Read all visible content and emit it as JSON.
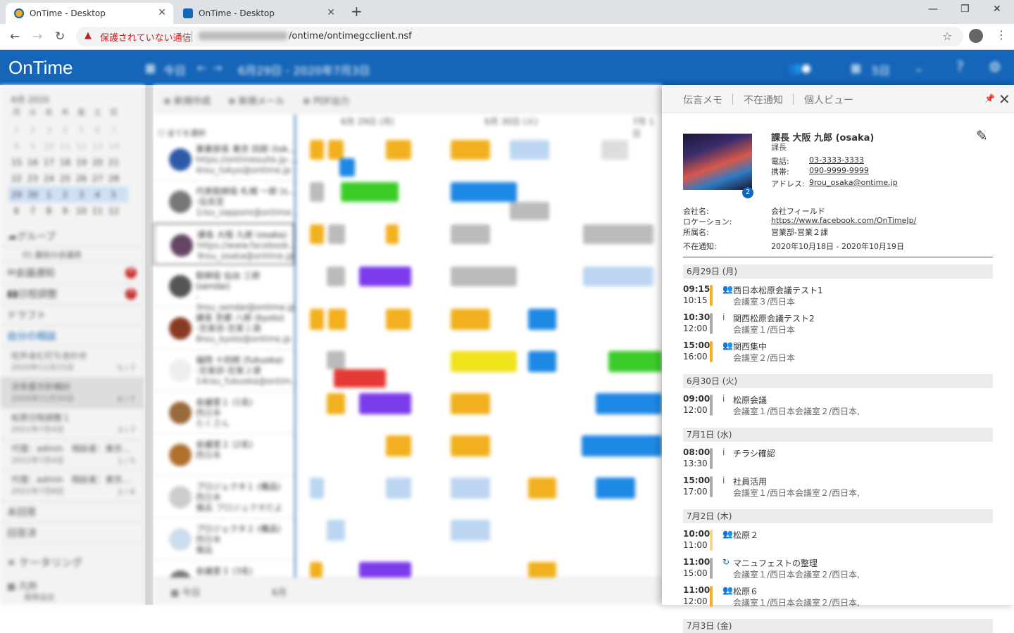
{
  "browser": {
    "tabs": [
      {
        "label": "OnTime - Desktop",
        "active": true
      },
      {
        "label": "OnTime - Desktop",
        "active": false
      }
    ],
    "new_tab_icon": "plus-icon",
    "security_warning": "保護されていない通信",
    "url_path": "/ontime/ontimegcclient.nsf",
    "window_controls": [
      "minimize-icon",
      "restore-icon",
      "close-icon"
    ]
  },
  "app": {
    "logo": "OnTime",
    "today": "今日",
    "date_range": "6月29日 - 2020年7月3日",
    "view_days": "5日",
    "accent_color": "#1565b8"
  },
  "sidebar": {
    "month": "6月 2020",
    "weekdays": [
      "月",
      "火",
      "水",
      "木",
      "金",
      "土",
      "日"
    ],
    "weeks": [
      [
        "1",
        "2",
        "3",
        "4",
        "5",
        "6",
        "7"
      ],
      [
        "8",
        "9",
        "10",
        "11",
        "12",
        "13",
        "14"
      ],
      [
        "15",
        "16",
        "17",
        "18",
        "19",
        "20",
        "21"
      ],
      [
        "22",
        "23",
        "24",
        "25",
        "26",
        "27",
        "28"
      ],
      [
        "29",
        "30",
        "1",
        "2",
        "3",
        "4",
        "5"
      ],
      [
        "6",
        "7",
        "8",
        "9",
        "10",
        "11",
        "12"
      ]
    ],
    "group_label": "グループ",
    "group_sub": "01.最段の会議用",
    "meeting_notice": "会議通知",
    "meeting_notice_count": "8",
    "schedule_adjust": "日程調整",
    "schedule_adjust_count": "5",
    "draft": "ドラフト",
    "my_consult": "自分の相談",
    "items": [
      {
        "title": "社外含む打ち合わせ",
        "date": "2020年11月15日",
        "count": "5 / 7"
      },
      {
        "title": "次年度方針検討",
        "date": "2020年11月30日",
        "count": "6 / 7"
      },
      {
        "title": "松原日程調整１",
        "date": "2021年7月4日",
        "count": "3 / 7"
      },
      {
        "title": "代理：admin　相談者：東京...",
        "date": "2021年7月4日",
        "count": "1 / 5"
      },
      {
        "title": "代理：admin　相談者：東京...",
        "date": "2021年7月8日",
        "count": "2 / 6"
      }
    ],
    "unanswered": "未回答",
    "answered": "回答済",
    "catering": "ケータリング",
    "legend": "凡例",
    "legend_sub": "標準設定"
  },
  "main": {
    "new_create": "新規作成",
    "new_mail": "新規メール",
    "pdf": "PDF出力",
    "select_all": "全てを選択",
    "day_headers": [
      "6月 29日 (月)",
      "6月 30日 (火)",
      "7月 1日"
    ],
    "people": [
      {
        "name": "事業部長 東京 四郎 (tok...",
        "sub": "https://ontimesuite.jp-...",
        "mail": "4rou_tokyo@ontime.jp"
      },
      {
        "name": "代表取締役 札幌 一郎 (s...",
        "sub": "-役員室",
        "mail": "1rou_sapporo@ontime..."
      },
      {
        "name": "課長 大阪 九郎 (osaka)",
        "sub": "https://www.facebook...",
        "mail": "9rou_osaka@ontime.jp"
      },
      {
        "name": "取締役 仙台 三郎 (sendai)",
        "sub": "-",
        "mail": "3rou_sendai@ontime.jp"
      },
      {
        "name": "課長 京都 八郎 (kyoto)",
        "sub": "-営業部-営業１課",
        "mail": "8rou_kyoto@ontime.jp"
      },
      {
        "name": "福岡 十四郎 (fukuoka)",
        "sub": "-営業部-営業２課",
        "mail": "14rou_fukuoka@ontim..."
      },
      {
        "name": "会議室１ (1名)",
        "sub": "西日本",
        "mail": "たくさん"
      },
      {
        "name": "会議室２ (2名)",
        "sub": "西日本",
        "mail": ""
      },
      {
        "name": "プロジェクタ１ (備品)",
        "sub": "西日本",
        "mail": "備品 プロジェクタだよ"
      },
      {
        "name": "プロジェクタ２ (備品)",
        "sub": "西日本",
        "mail": "備品"
      },
      {
        "name": "会議室３ (3名)",
        "sub": "",
        "mail": ""
      }
    ],
    "bottom_today": "今日",
    "bottom_month": "6月"
  },
  "panel": {
    "tabs": [
      "伝言メモ",
      "不在通知",
      "個人ビュー"
    ],
    "badge": "2",
    "name": "課長 大阪 九郎 (osaka)",
    "title": "課長",
    "phone_label": "電話:",
    "phone": "03-3333-3333",
    "mobile_label": "携帯:",
    "mobile": "090-9999-9999",
    "address_label": "アドレス:",
    "address": "9rou_osaka@ontime.jp",
    "company_label": "会社名:",
    "company": "会社フィールド",
    "location_label": "ロケーション:",
    "location": "https://www.facebook.com/OnTimeJp/",
    "dept_label": "所属名:",
    "dept": "営業部-営業２課",
    "absence_label": "不在通知:",
    "absence": "2020年10月18日 - 2020年10月19日",
    "days": [
      {
        "label": "6月29日 (月)",
        "events": [
          {
            "start": "09:15",
            "end": "10:15",
            "title": "西日本松原会議テスト1",
            "loc": "会議室３/西日本",
            "color": "#f2b01e",
            "icon": "people-icon"
          },
          {
            "start": "10:30",
            "end": "12:00",
            "title": "関西松原会議テスト2",
            "loc": "会議室１/西日本",
            "color": "#aaaaaa",
            "icon": "info-icon"
          },
          {
            "start": "15:00",
            "end": "16:00",
            "title": "関西集中",
            "loc": "会議室２/西日本",
            "color": "#f2b01e",
            "icon": "people-icon"
          }
        ]
      },
      {
        "label": "6月30日 (火)",
        "events": [
          {
            "start": "09:00",
            "end": "12:00",
            "title": "松原会議",
            "loc": "会議室１/西日本会議室２/西日本,",
            "color": "#aaaaaa",
            "icon": "info-icon"
          }
        ]
      },
      {
        "label": "7月1日 (水)",
        "events": [
          {
            "start": "08:00",
            "end": "13:30",
            "title": "チラシ確認",
            "loc": "",
            "color": "#aaaaaa",
            "icon": "info-icon"
          },
          {
            "start": "15:00",
            "end": "17:00",
            "title": "社員活用",
            "loc": "会議室１/西日本会議室２/西日本,",
            "color": "#aaaaaa",
            "icon": "info-icon"
          }
        ]
      },
      {
        "label": "7月2日 (木)",
        "events": [
          {
            "start": "10:00",
            "end": "11:00",
            "title": "松原２",
            "loc": "",
            "color": "#f7d88a",
            "icon": "people-icon"
          },
          {
            "start": "11:00",
            "end": "15:00",
            "title": "マニュフェストの整理",
            "loc": "会議室１/西日本会議室２/西日本,",
            "color": "#aaaaaa",
            "icon": "repeat-icon"
          },
          {
            "start": "11:00",
            "end": "12:00",
            "title": "松原６",
            "loc": "会議室１/西日本会議室２/西日本,",
            "color": "#f2b01e",
            "icon": "people-icon"
          }
        ]
      },
      {
        "label": "7月3日 (金)",
        "events": []
      }
    ]
  }
}
